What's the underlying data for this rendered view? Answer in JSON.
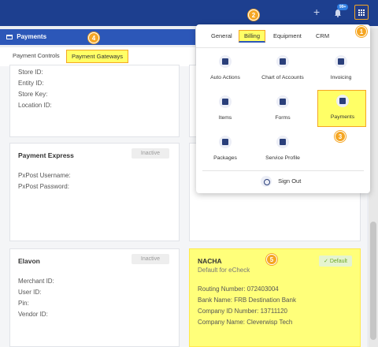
{
  "topbar": {
    "plus": "+",
    "notification_badge": "99+"
  },
  "markers": [
    "1",
    "2",
    "3",
    "4",
    "5"
  ],
  "panel": {
    "title": "Payments"
  },
  "tabs": {
    "controls": "Payment Controls",
    "gateways": "Payment Gateways"
  },
  "cards": {
    "top_fields": [
      "Store ID:",
      "Entity ID:",
      "Store Key:",
      "Location ID:"
    ],
    "payment_express": {
      "title": "Payment Express",
      "status": "Inactive",
      "fields": [
        "PxPost Username:",
        "PxPost Password:"
      ]
    },
    "elavon": {
      "title": "Elavon",
      "status": "Inactive",
      "fields": [
        "Merchant ID:",
        "User ID:",
        "Pin:",
        "Vendor ID:"
      ]
    },
    "nacha": {
      "title": "NACHA",
      "subtitle": "Default for eCheck",
      "status": "Default",
      "fields": [
        "Routing Number: 072403004",
        "Bank Name: FRB Destination Bank",
        "Company ID Number: 13711120",
        "Company Name: Cleverwisp Tech"
      ]
    }
  },
  "dropdown": {
    "tabs": [
      "General",
      "Billing",
      "Equipment",
      "CRM"
    ],
    "items": [
      {
        "label": "Auto Actions",
        "icon": "waveform-icon"
      },
      {
        "label": "Chart of Accounts",
        "icon": "hierarchy-icon"
      },
      {
        "label": "Invoicing",
        "icon": "document-icon"
      },
      {
        "label": "Items",
        "icon": "printer-icon"
      },
      {
        "label": "Forms",
        "icon": "list-icon"
      },
      {
        "label": "Payments",
        "icon": "payment-card-icon"
      },
      {
        "label": "Packages",
        "icon": "layers-icon"
      },
      {
        "label": "Service Profile",
        "icon": "settings-icon"
      }
    ],
    "signout": "Sign Out"
  }
}
